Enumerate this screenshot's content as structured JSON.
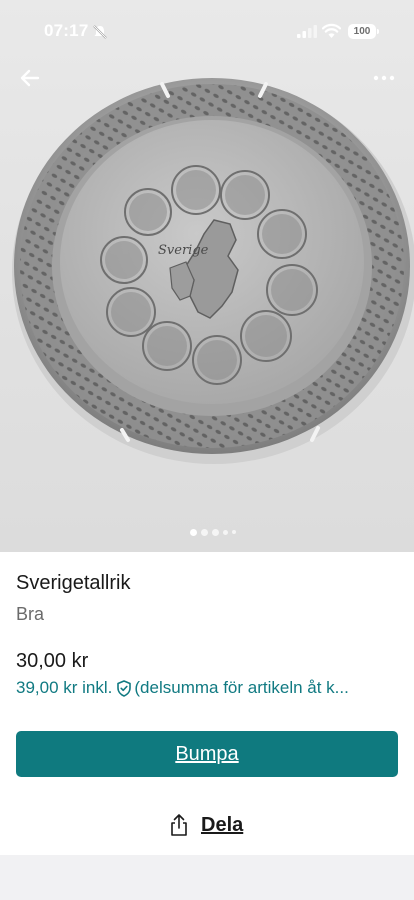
{
  "status_bar": {
    "time": "07:17",
    "battery": "100",
    "mute_icon": "bell-slash-icon",
    "signal_icon": "cellular-signal-icon",
    "wifi_icon": "wifi-icon"
  },
  "nav": {
    "back_icon": "arrow-left-icon",
    "more_icon": "more-horizontal-icon"
  },
  "gallery": {
    "image_subject": "decorative pewter plate with Sweden map",
    "plate_text": "Sverige",
    "page_count": 5,
    "active_page": 1
  },
  "item": {
    "title": "Sverigetallrik",
    "condition": "Bra",
    "price": "30,00 kr",
    "price_incl": "39,00 kr inkl.",
    "price_incl_note": "(delsumma för artikeln åt k...",
    "price_incl_icon": "shield-check-icon"
  },
  "actions": {
    "bump_label": "Bumpa",
    "share_label": "Dela",
    "share_icon": "share-icon"
  },
  "colors": {
    "accent": "#0f7a7f",
    "link": "#117a82",
    "secondary_text": "#6b6b6b"
  }
}
